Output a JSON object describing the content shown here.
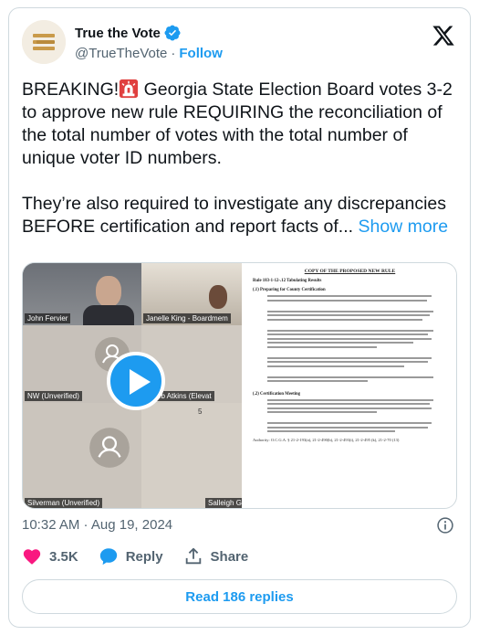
{
  "author": {
    "display_name": "True the Vote",
    "handle": "@TrueTheVote",
    "separator": "·",
    "follow_label": "Follow"
  },
  "tweet": {
    "text_part1": "BREAKING!",
    "text_part2": " Georgia State Election Board votes 3-2 to approve new rule REQUIRING the reconciliation of the total number of votes with the total number of unique voter ID numbers.\n\nThey’re also required to investigate any discrepancies BEFORE certification and report facts of... ",
    "show_more": "Show more"
  },
  "media": {
    "video_labels": {
      "tile1": "John Fervier",
      "tile2": "Janelle King - Boardmem",
      "tile3": "NW (Unverified)",
      "tile4": "Caleb Atkins (Elevat",
      "tile5": "Silverman (Unverified)",
      "tile6": "Salleigh Grubb",
      "tile5_num": "5"
    },
    "document": {
      "title": "COPY OF THE PROPOSED NEW RULE",
      "rule": "Rule 183-1-12-.12 Tabulating Results",
      "section1": "(.1) Preparing for County Certification",
      "section2": "(.2) Certification Meeting",
      "authority": "Authority: O.C.G.A. § 21-2-193(a), 21-2-490(b), 21-2-493(i), 21-2-495 (k), 21-2-70 (13)"
    }
  },
  "timestamp": "10:32 AM · Aug 19, 2024",
  "actions": {
    "likes": "3.5K",
    "reply_label": "Reply",
    "share_label": "Share"
  },
  "read_replies": "Read 186 replies",
  "colors": {
    "accent": "#1d9bf0",
    "like": "#f91880",
    "text_secondary": "#536471"
  }
}
